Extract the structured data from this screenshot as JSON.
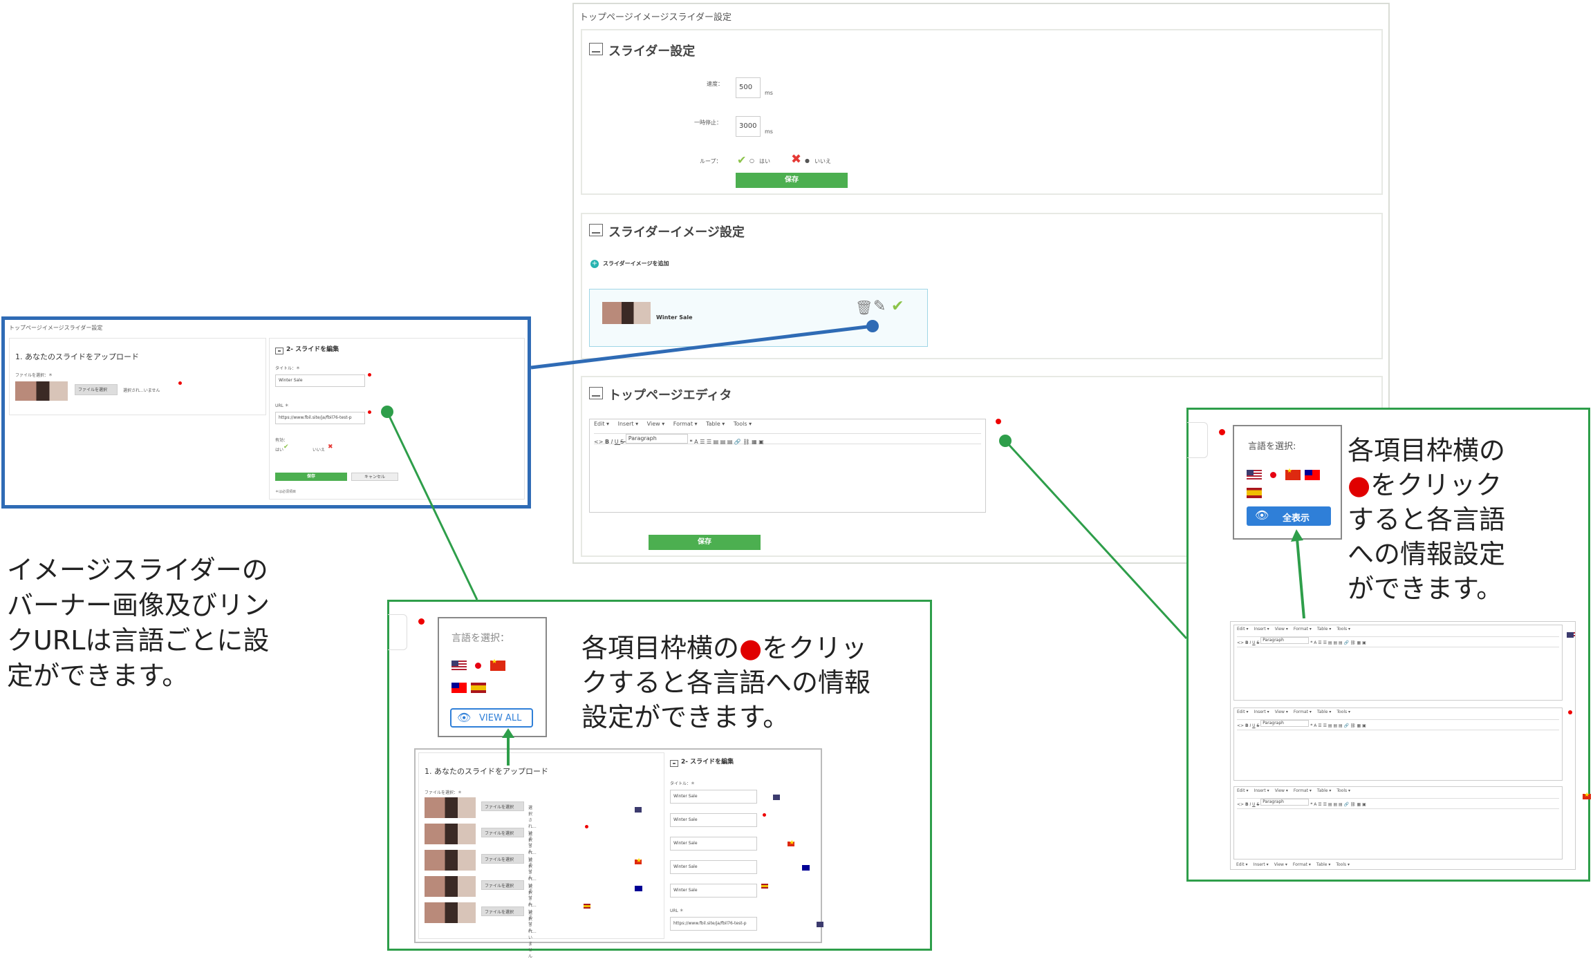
{
  "main_panel": {
    "title": "トップページイメージスライダー設定",
    "slider_settings": {
      "heading": "スライダー設定",
      "speed_label": "速度：",
      "speed_value": "500",
      "speed_unit": "ms",
      "pause_label": "一時停止：",
      "pause_value": "3000",
      "pause_unit": "ms",
      "loop_label": "ループ：",
      "loop_yes": "はい",
      "loop_no": "いいえ",
      "save": "保存"
    },
    "image_settings": {
      "heading": "スライダーイメージ設定",
      "add_label": "スライダーイメージを追加",
      "slide_title": "Winter Sale"
    },
    "editor": {
      "heading": "トップページエディタ",
      "menu": [
        "Edit ▾",
        "Insert ▾",
        "View ▾",
        "Format ▾",
        "Table ▾",
        "Tools ▾"
      ],
      "format_select": "Paragraph",
      "save": "保存"
    }
  },
  "left_screenshot": {
    "title": "トップページイメージスライダー設定",
    "upload_heading": "1. あなたのスライドをアップロード",
    "file_label": "ファイルを選択：＊",
    "file_button": "ファイルを選択",
    "file_status": "選択され...いません",
    "edit_heading": "2- スライドを編集",
    "title_label": "タイトル：＊",
    "title_value": "Winter Sale",
    "url_label": "URL ＊",
    "url_value": "https://www.fbil.site/ja/fbil76-test-p",
    "active_label": "有効：",
    "yes": "はい",
    "no": "いいえ",
    "save": "保存",
    "cancel": "キャンセル",
    "required_note": "＊は必須項目"
  },
  "left_annotation": "イメージスライダーの\nバーナー画像及びリン\nクURLは言語ごとに設\n定ができます。",
  "center_callout": {
    "lang_label": "言語を選択：",
    "view_all": "VIEW ALL",
    "text": "各項目枠横の●をクリッ\nクすると各言語への情報\n設定ができます。",
    "upload_heading": "1. あなたのスライドをアップロード",
    "file_label": "ファイルを選択：＊",
    "file_button": "ファイルを選択",
    "file_status": "選択され...いません",
    "edit_heading": "2- スライドを編集",
    "title_label": "タイトル：＊",
    "title_value": "Winter Sale",
    "url_label": "URL ＊",
    "url_value": "https://www.fbil.site/ja/fbil76-test-p"
  },
  "right_callout": {
    "lang_label": "言語を選択:",
    "view_all": "全表示",
    "text": "各項目枠横の\n●をクリック\nすると各言語\nへの情報設定\nができます。",
    "menu": [
      "Edit ▾",
      "Insert ▾",
      "View ▾",
      "Format ▾",
      "Table ▾",
      "Tools ▾"
    ],
    "format_select": "Paragraph"
  },
  "colors": {
    "green_button": "#4caf50",
    "callout_border": "#2e9e4a",
    "screenshot_border": "#2f6bb5",
    "red_dot": "#e00000",
    "view_all_blue": "#2f7fd8"
  }
}
